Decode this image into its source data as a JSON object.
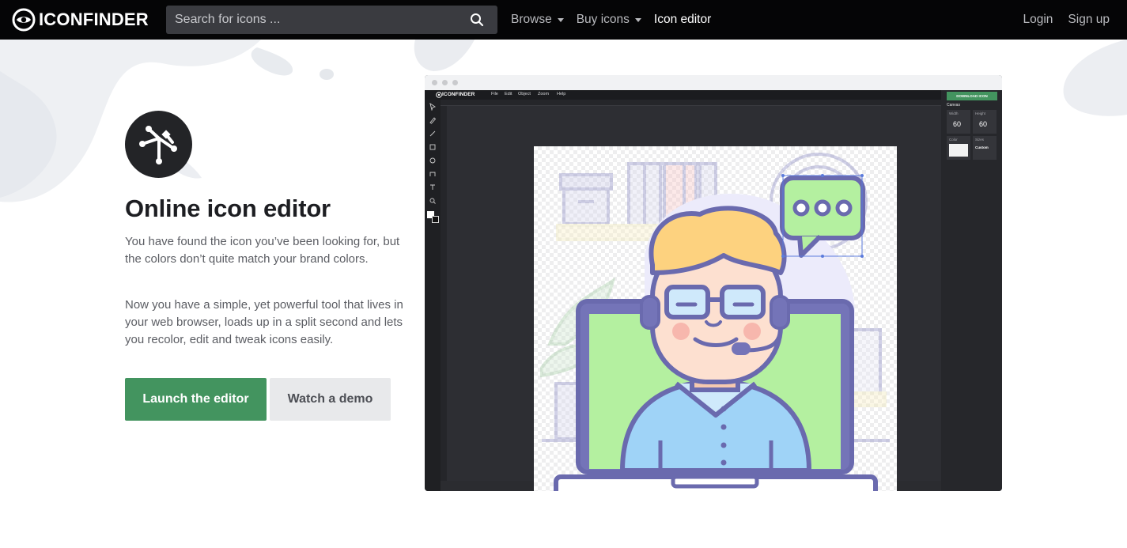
{
  "header": {
    "logo_text": "ICONFINDER",
    "search_placeholder": "Search for icons ...",
    "nav": [
      {
        "label": "Browse",
        "has_dropdown": true
      },
      {
        "label": "Buy icons",
        "has_dropdown": true
      },
      {
        "label": "Icon editor",
        "has_dropdown": false,
        "active": true
      }
    ],
    "login": "Login",
    "signup": "Sign up"
  },
  "hero": {
    "icon": "vector-nodes-icon",
    "title": "Online icon editor",
    "paragraph1": "You have found the icon you’ve been looking for, but the colors don’t quite match your brand colors.",
    "paragraph2": "Now you have a simple, yet powerful tool that lives in your web browser, loads up in a split second and lets you recolor, edit and tweak icons easily.",
    "primary_button": "Launch the editor",
    "secondary_button": "Watch a demo"
  },
  "editor_preview": {
    "logo_text": "ICONFINDER",
    "menu": [
      "File",
      "Edit",
      "Object",
      "Zoom",
      "Help"
    ],
    "download_button": "DOWNLOAD ICON",
    "panel_title": "Canvas",
    "width_label": "Width",
    "width_value": "60",
    "height_label": "Height",
    "height_value": "60",
    "color_label": "Color",
    "sizes_label": "Sizes",
    "sizes_value": "Custom"
  },
  "colors": {
    "topbar": "#050506",
    "primary_green": "#43945f",
    "secondary_gray": "#e8e9eb",
    "illustration_stroke": "#6f6fb0",
    "screen_green": "#b4f0a0",
    "hair_yellow": "#fdd27f",
    "shirt_blue": "#9fd3f7"
  }
}
